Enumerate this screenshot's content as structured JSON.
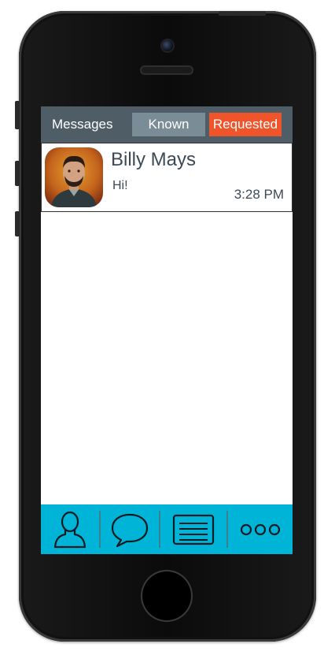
{
  "header": {
    "title": "Messages",
    "tabs": [
      {
        "label": "Known",
        "color": "#7a8c95"
      },
      {
        "label": "Requested",
        "color": "#f0542a",
        "active": true
      }
    ]
  },
  "messages": [
    {
      "sender": "Billy Mays",
      "preview": "Hi!",
      "time": "3:28 PM",
      "avatar_icon": "person-photo"
    }
  ],
  "bottom_nav": [
    {
      "icon": "person-icon"
    },
    {
      "icon": "chat-bubble-icon"
    },
    {
      "icon": "list-document-icon"
    },
    {
      "icon": "more-icon"
    }
  ],
  "colors": {
    "header_bg": "#4f5d66",
    "nav_bg": "#00b4d8",
    "accent": "#f0542a"
  }
}
